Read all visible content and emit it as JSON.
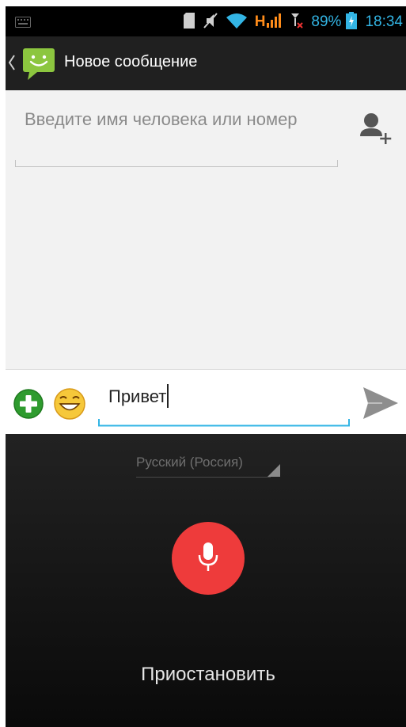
{
  "status_bar": {
    "battery": "89%",
    "time": "18:34",
    "network": "H",
    "icons": [
      "keyboard-icon",
      "sd-card-icon",
      "mute-icon",
      "wifi-icon",
      "signal-icon",
      "signal-nosim-icon",
      "battery-charging-icon"
    ]
  },
  "action_bar": {
    "title": "Новое сообщение",
    "icons": [
      "back-chevron-icon",
      "messaging-app-icon"
    ]
  },
  "recipient": {
    "placeholder": "Введите имя человека или номер",
    "icons": [
      "add-contact-icon"
    ]
  },
  "compose": {
    "message": "Привет",
    "icons": [
      "attach-plus-icon",
      "emoji-icon",
      "send-icon"
    ]
  },
  "voice": {
    "language": "Русский (Россия)",
    "pause_label": "Приостановить",
    "icons": [
      "microphone-icon",
      "dropdown-corner-icon"
    ]
  },
  "colors": {
    "accent": "#33b5e5",
    "mic_button": "#ee3b3b",
    "attach_green": "#2e9b2e",
    "action_bar": "#202020"
  }
}
